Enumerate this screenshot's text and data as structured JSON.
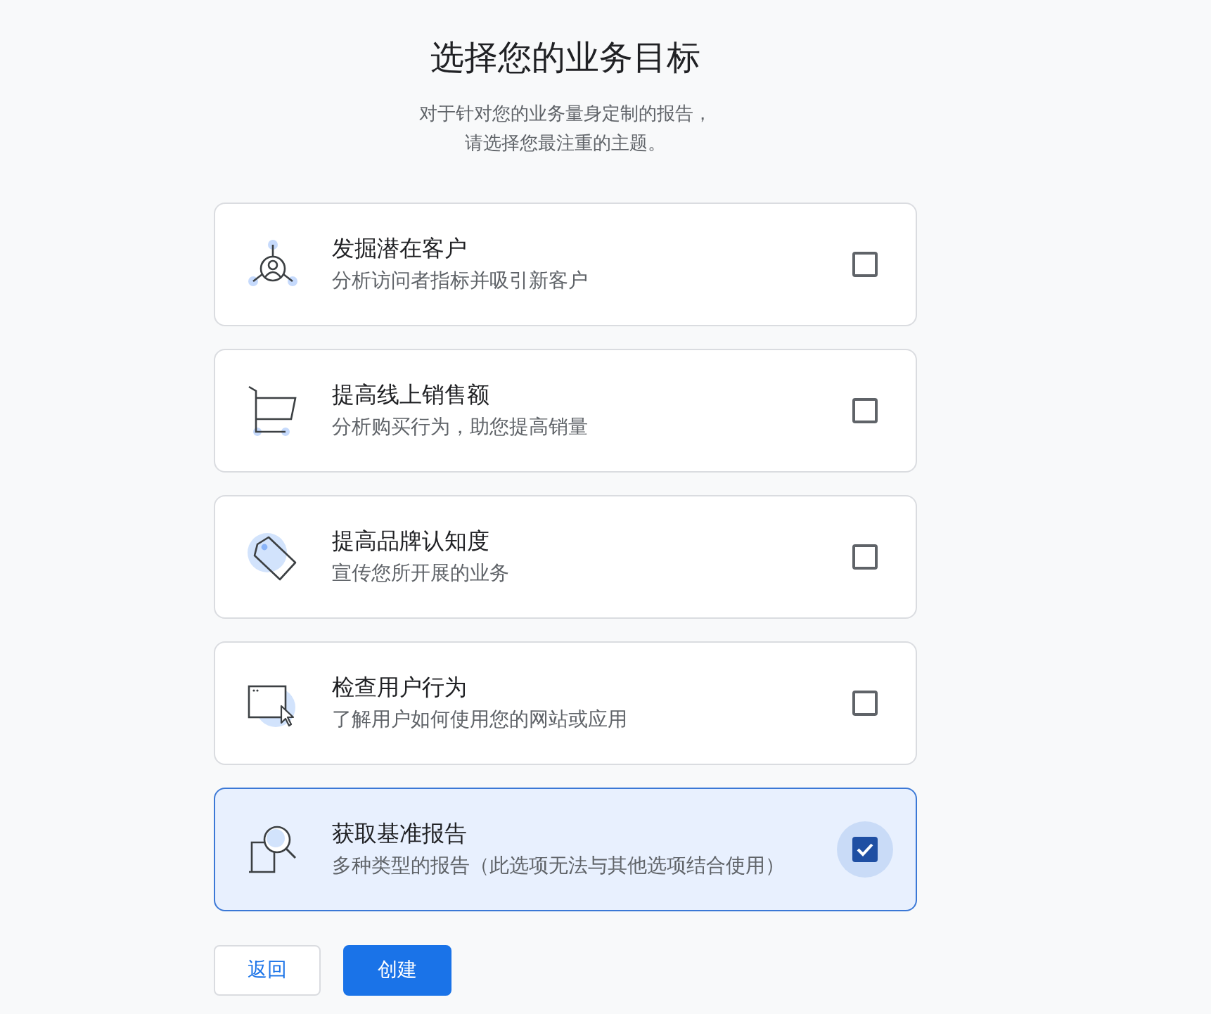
{
  "header": {
    "title": "选择您的业务目标",
    "subtitle_lines": [
      "对于针对您的业务量身定制的报告，",
      "请选择您最注重的主题。"
    ]
  },
  "goals": [
    {
      "title": "发掘潜在客户",
      "description": "分析访问者指标并吸引新客户",
      "checked": false
    },
    {
      "title": "提高线上销售额",
      "description": "分析购买行为，助您提高销量",
      "checked": false
    },
    {
      "title": "提高品牌认知度",
      "description": "宣传您所开展的业务",
      "checked": false
    },
    {
      "title": "检查用户行为",
      "description": "了解用户如何使用您的网站或应用",
      "checked": false
    },
    {
      "title": "获取基准报告",
      "description": "多种类型的报告（此选项无法与其他选项结合使用）",
      "checked": true
    }
  ],
  "buttons": [
    {
      "kind": "secondary",
      "label": "返回"
    },
    {
      "kind": "primary",
      "label": "创建"
    }
  ]
}
